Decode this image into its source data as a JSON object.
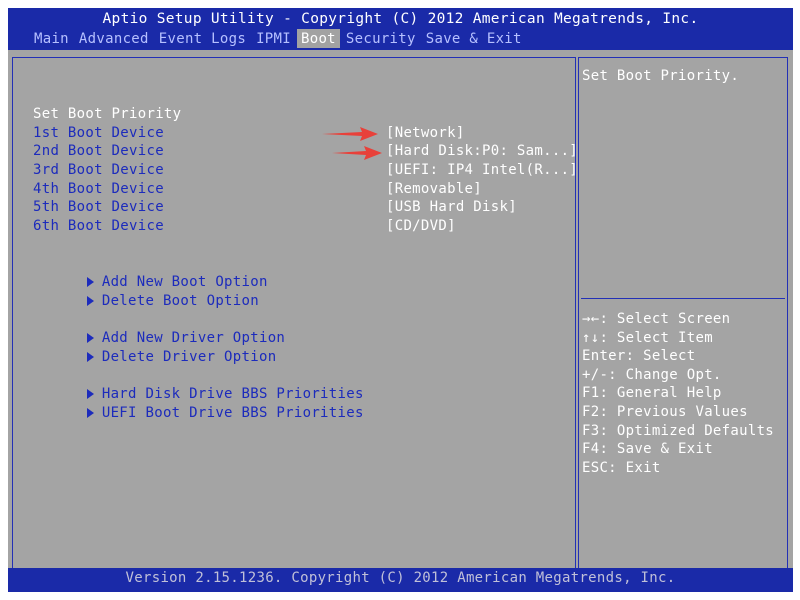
{
  "header": {
    "title": "Aptio Setup Utility - Copyright (C) 2012 American Megatrends, Inc.",
    "tabs": [
      {
        "label": "Main"
      },
      {
        "label": "Advanced"
      },
      {
        "label": "Event Logs"
      },
      {
        "label": "IPMI"
      },
      {
        "label": "Boot"
      },
      {
        "label": "Security"
      },
      {
        "label": "Save & Exit"
      }
    ],
    "active_tab": "Boot"
  },
  "boot": {
    "section_title": "Set Boot Priority",
    "devices": [
      {
        "label": "1st Boot Device",
        "value": "[Network]"
      },
      {
        "label": "2nd Boot Device",
        "value": "[Hard Disk:P0: Sam...]"
      },
      {
        "label": "3rd Boot Device",
        "value": "[UEFI: IP4 Intel(R...]"
      },
      {
        "label": "4th Boot Device",
        "value": "[Removable]"
      },
      {
        "label": "5th Boot Device",
        "value": "[USB Hard Disk]"
      },
      {
        "label": "6th Boot Device",
        "value": "[CD/DVD]"
      }
    ],
    "submenus": [
      {
        "label": "Add New Boot Option"
      },
      {
        "label": "Delete Boot Option"
      },
      {
        "label": "Add New Driver Option"
      },
      {
        "label": "Delete Driver Option"
      },
      {
        "label": "Hard Disk Drive BBS Priorities"
      },
      {
        "label": "UEFI Boot Drive BBS Priorities"
      }
    ]
  },
  "help": {
    "description": "Set Boot Priority.",
    "keys": [
      "→←: Select Screen",
      "↑↓: Select Item",
      "Enter: Select",
      "+/-: Change Opt.",
      "F1: General Help",
      "F2: Previous Values",
      "F3: Optimized Defaults",
      "F4: Save & Exit",
      "ESC: Exit"
    ]
  },
  "footer": {
    "version": "Version 2.15.1236. Copyright (C) 2012 American Megatrends, Inc."
  },
  "colors": {
    "header_bg": "#1a2aa8",
    "body_bg": "#a4a4a4",
    "item_label": "#1c2bbc",
    "value_text": "#ffffff",
    "annotation_arrow": "#e8413a"
  }
}
